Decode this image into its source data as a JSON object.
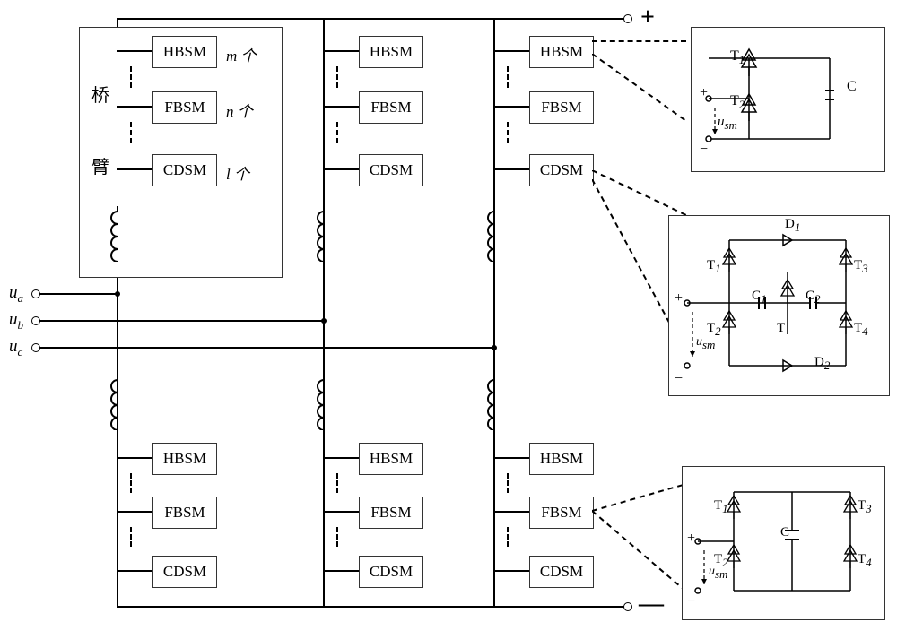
{
  "dc_bus": {
    "positive": "+",
    "negative": "—"
  },
  "ac_terminals": {
    "ua": "u",
    "ua_sub": "a",
    "ub": "u",
    "ub_sub": "b",
    "uc": "u",
    "uc_sub": "c"
  },
  "arm_box_label": {
    "line1": "桥",
    "line2": "臂"
  },
  "submodule_types": {
    "hbsm": "HBSM",
    "fbsm": "FBSM",
    "cdsm": "CDSM"
  },
  "counts": {
    "hbsm": "m 个",
    "fbsm": "n 个",
    "cdsm": "l 个"
  },
  "detail": {
    "hb": {
      "t1": "T",
      "t1s": "1",
      "t2": "T",
      "t2s": "2",
      "c": "C",
      "usm": "u",
      "usms": "sm",
      "plus": "+",
      "minus": "−"
    },
    "cd": {
      "t1": "T",
      "t1s": "1",
      "t2": "T",
      "t2s": "2",
      "t3": "T",
      "t3s": "3",
      "t4": "T",
      "t4s": "4",
      "tm": "T",
      "d1": "D",
      "d1s": "1",
      "d2": "D",
      "d2s": "2",
      "c1": "C",
      "c1s": "1",
      "c2": "C",
      "c2s": "2",
      "usm": "u",
      "usms": "sm",
      "plus": "+",
      "minus": "−"
    },
    "fb": {
      "t1": "T",
      "t1s": "1",
      "t2": "T",
      "t2s": "2",
      "t3": "T",
      "t3s": "3",
      "t4": "T",
      "t4s": "4",
      "c": "C",
      "usm": "u",
      "usms": "sm",
      "plus": "+",
      "minus": "−"
    }
  }
}
